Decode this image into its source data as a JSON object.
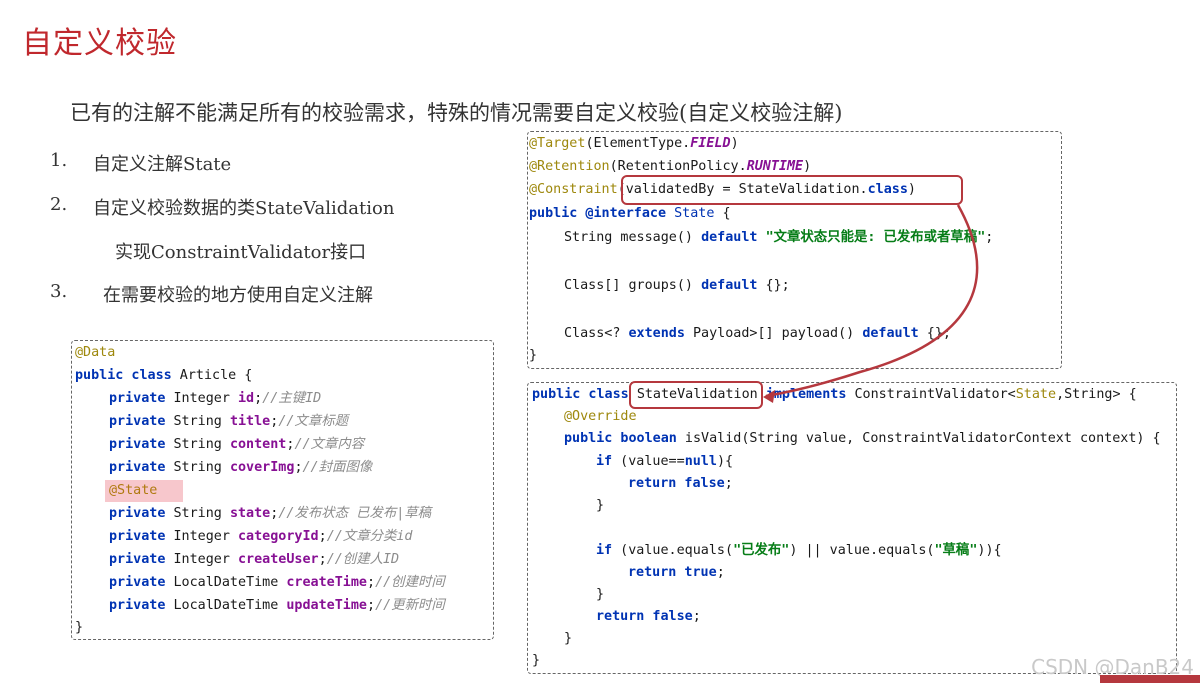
{
  "title": "自定义校验",
  "subtitle": "已有的注解不能满足所有的校验需求，特殊的情况需要自定义校验(自定义校验注解)",
  "list": [
    {
      "num": "1.",
      "text": "自定义注解State"
    },
    {
      "num": "2.",
      "text": "自定义校验数据的类StateValidation"
    },
    {
      "num": "",
      "text": "实现ConstraintValidator接口"
    },
    {
      "num": "3.",
      "text": "在需要校验的地方使用自定义注解"
    }
  ],
  "annotation_code": {
    "l1_ann": "@Target",
    "l1_rest": "(ElementType.",
    "l1_field": "FIELD",
    "l1_end": ")",
    "l2_ann": "@Retention",
    "l2_rest": "(RetentionPolicy.",
    "l2_field": "RUNTIME",
    "l2_end": ")",
    "l3_ann": "@Constraint",
    "l3_rest": "(validatedBy = StateValidation.",
    "l3_kw": "class",
    "l3_end": ")",
    "l4_kw": "public @interface",
    "l4_type": "State",
    "l4_end": " {",
    "l5_pre": "String message() ",
    "l5_kw": "default",
    "l5_str": "\"文章状态只能是: 已发布或者草稿\"",
    "l5_end": ";",
    "l6_pre": "Class[] groups() ",
    "l6_kw": "default",
    "l6_end": " {};",
    "l7_pre": "Class<? ",
    "l7_kw1": "extends",
    "l7_mid": " Payload>[] payload() ",
    "l7_kw2": "default",
    "l7_end": " {};",
    "l8": "}"
  },
  "validator_code": {
    "l1_kw": "public class",
    "l1_name": "StateValidation",
    "l1_kw2": "implements",
    "l1_pre": "ConstraintValidator<",
    "l1_type": "State",
    "l1_end": ",String> {",
    "l2_ann": "@Override",
    "l3_kw": "public boolean",
    "l3_rest": " isValid(String value, ConstraintValidatorContext context) {",
    "l4_kw": "if",
    "l4_a": " (value==",
    "l4_kw2": "null",
    "l4_b": "){",
    "l5_kw": "return false",
    "l5_end": ";",
    "l6": "}",
    "l7_kw": "if",
    "l7_a": " (value.equals(",
    "l7_s1": "\"已发布\"",
    "l7_b": ") || value.equals(",
    "l7_s2": "\"草稿\"",
    "l7_c": ")){",
    "l8_kw": "return true",
    "l8_end": ";",
    "l9": "}",
    "l10_kw": "return false",
    "l10_end": ";",
    "l11": "}",
    "l12": "}"
  },
  "article_code": {
    "ann_data": "@Data",
    "l2_kw": "public class",
    "l2_rest": " Article {",
    "fields": [
      {
        "kw": "private",
        "type": " Integer ",
        "name": "id",
        "comment": "//主键ID"
      },
      {
        "kw": "private",
        "type": " String ",
        "name": "title",
        "comment": "//文章标题"
      },
      {
        "kw": "private",
        "type": " String ",
        "name": "content",
        "comment": "//文章内容"
      },
      {
        "kw": "private",
        "type": " String ",
        "name": "coverImg",
        "comment": "//封面图像"
      }
    ],
    "ann_state": "@State",
    "fields2": [
      {
        "kw": "private",
        "type": " String ",
        "name": "state",
        "comment": "//发布状态 已发布|草稿"
      },
      {
        "kw": "private",
        "type": " Integer ",
        "name": "categoryId",
        "comment": "//文章分类id"
      },
      {
        "kw": "private",
        "type": " Integer ",
        "name": "createUser",
        "comment": "//创建人ID"
      },
      {
        "kw": "private",
        "type": " LocalDateTime ",
        "name": "createTime",
        "comment": "//创建时间"
      },
      {
        "kw": "private",
        "type": " LocalDateTime ",
        "name": "updateTime",
        "comment": "//更新时间"
      }
    ],
    "end": "}"
  },
  "watermark": "CSDN @DanB24",
  "colors": {
    "accent": "#b5383e",
    "title": "#c0282d"
  }
}
